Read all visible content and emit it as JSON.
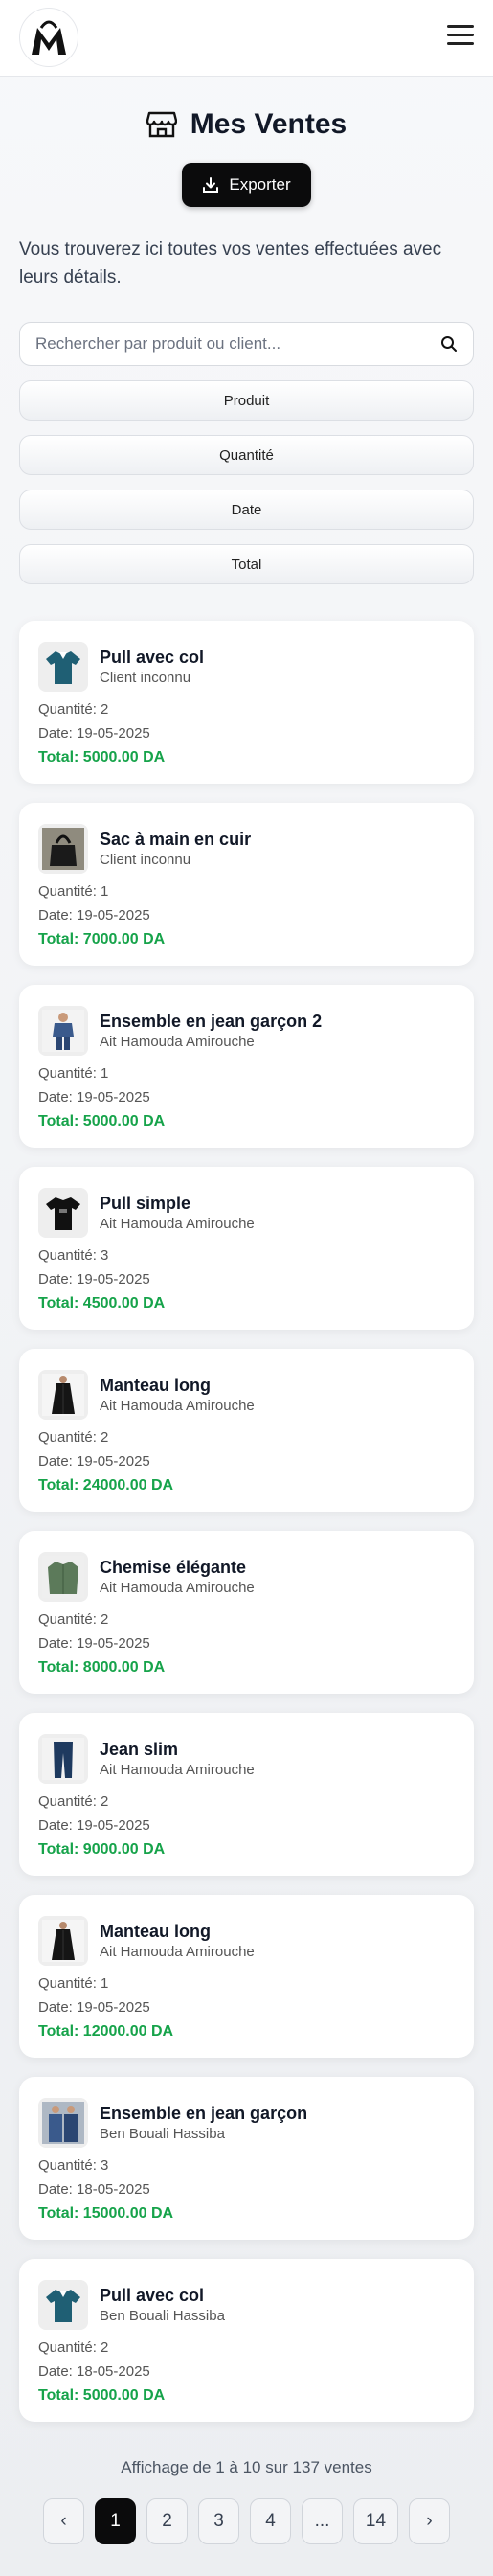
{
  "header": {
    "logo_letter": "M",
    "menu_icon": "hamburger-icon"
  },
  "page": {
    "title": "Mes Ventes",
    "title_icon": "store-icon",
    "export_label": "Exporter",
    "intro": "Vous trouverez ici toutes vos ventes effectuées avec leurs détails.",
    "search_placeholder": "Rechercher par produit ou client...",
    "sort_buttons": [
      "Produit",
      "Quantité",
      "Date",
      "Total"
    ]
  },
  "sales": [
    {
      "product": "Pull avec col",
      "client": "Client inconnu",
      "qty": "Quantité: 2",
      "date": "Date: 19-05-2025",
      "total": "Total: 5000.00 DA",
      "thumb": "polo-teal"
    },
    {
      "product": "Sac à main en cuir",
      "client": "Client inconnu",
      "qty": "Quantité: 1",
      "date": "Date: 19-05-2025",
      "total": "Total: 7000.00 DA",
      "thumb": "bag-black"
    },
    {
      "product": "Ensemble en jean garçon 2",
      "client": "Ait Hamouda Amirouche",
      "qty": "Quantité: 1",
      "date": "Date: 19-05-2025",
      "total": "Total: 5000.00 DA",
      "thumb": "denim-kid"
    },
    {
      "product": "Pull simple",
      "client": "Ait Hamouda Amirouche",
      "qty": "Quantité: 3",
      "date": "Date: 19-05-2025",
      "total": "Total: 4500.00 DA",
      "thumb": "tshirt-black"
    },
    {
      "product": "Manteau long",
      "client": "Ait Hamouda Amirouche",
      "qty": "Quantité: 2",
      "date": "Date: 19-05-2025",
      "total": "Total: 24000.00 DA",
      "thumb": "coat-black"
    },
    {
      "product": "Chemise élégante",
      "client": "Ait Hamouda Amirouche",
      "qty": "Quantité: 2",
      "date": "Date: 19-05-2025",
      "total": "Total: 8000.00 DA",
      "thumb": "shirt-green"
    },
    {
      "product": "Jean slim",
      "client": "Ait Hamouda Amirouche",
      "qty": "Quantité: 2",
      "date": "Date: 19-05-2025",
      "total": "Total: 9000.00 DA",
      "thumb": "jeans-navy"
    },
    {
      "product": "Manteau long",
      "client": "Ait Hamouda Amirouche",
      "qty": "Quantité: 1",
      "date": "Date: 19-05-2025",
      "total": "Total: 12000.00 DA",
      "thumb": "coat-black"
    },
    {
      "product": "Ensemble en jean garçon",
      "client": "Ben Bouali Hassiba",
      "qty": "Quantité: 3",
      "date": "Date: 18-05-2025",
      "total": "Total: 15000.00 DA",
      "thumb": "denim-kids"
    },
    {
      "product": "Pull avec col",
      "client": "Ben Bouali Hassiba",
      "qty": "Quantité: 2",
      "date": "Date: 18-05-2025",
      "total": "Total: 5000.00 DA",
      "thumb": "polo-teal"
    }
  ],
  "pagination": {
    "info": "Affichage de 1 à 10 sur 137 ventes",
    "prev": "‹",
    "pages": [
      "1",
      "2",
      "3",
      "4",
      "...",
      "14"
    ],
    "next": "›",
    "active": "1"
  }
}
